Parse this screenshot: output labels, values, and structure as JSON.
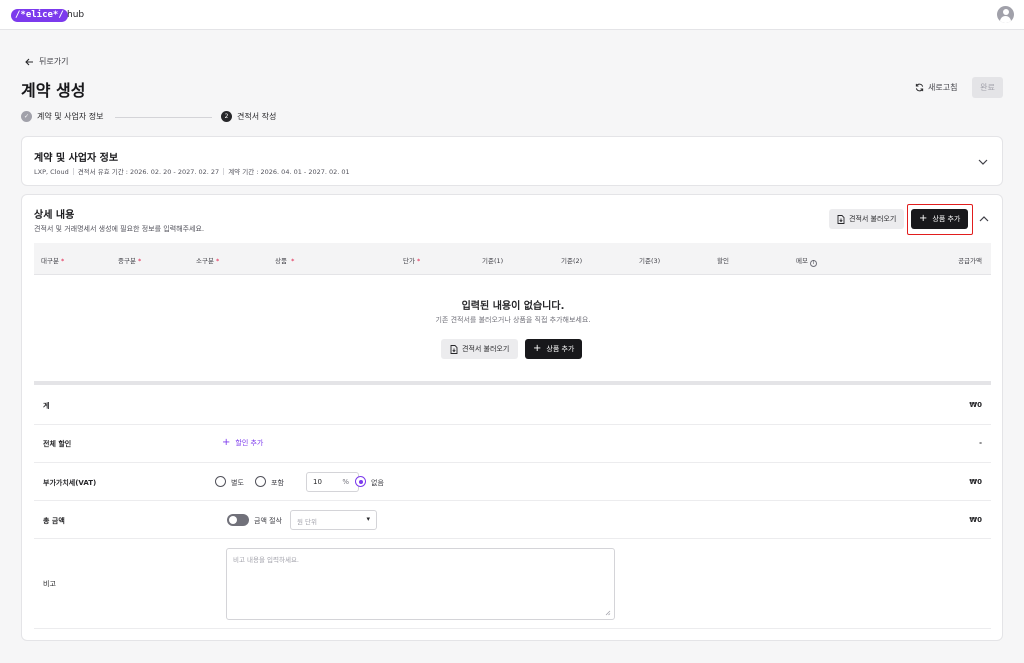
{
  "header": {
    "logo_text": "/*elice*/",
    "hub_label": "hub",
    "profile_icon": "user-avatar-icon"
  },
  "nav": {
    "back_label": "뒤로가기"
  },
  "page": {
    "title": "계약 생성",
    "refresh_label": "새로고침",
    "done_label": "완료"
  },
  "steps": [
    {
      "number": "✓",
      "label": "계약 및 사업자 정보",
      "status": "completed"
    },
    {
      "number": "2",
      "label": "견적서 작성",
      "status": "current"
    }
  ],
  "contract_card": {
    "title": "계약 및 사업자 정보",
    "products": "LXP, Cloud",
    "quote_validity": "견적서 유효 기간 : 2026. 02. 20 - 2027. 02. 27",
    "contract_period": "계약 기간 : 2026. 04. 01 - 2027. 02. 01"
  },
  "detail_card": {
    "title": "상세 내용",
    "subtitle": "견적서 및 거래명세서 생성에 필요한 정보를 입력해주세요.",
    "load_quote_label": "견적서 불러오기",
    "add_product_label": "상품 추가",
    "columns": [
      {
        "label": "대구분",
        "required": true
      },
      {
        "label": "중구분",
        "required": true
      },
      {
        "label": "소구분",
        "required": true
      },
      {
        "label": "상품",
        "required": true
      },
      {
        "label": "단가",
        "required": true
      },
      {
        "label": "기준(1)",
        "required": false
      },
      {
        "label": "기준(2)",
        "required": false
      },
      {
        "label": "기준(3)",
        "required": false
      },
      {
        "label": "할인",
        "required": false
      },
      {
        "label": "메모",
        "required": false
      },
      {
        "label": "공급가액",
        "required": false
      }
    ],
    "empty_title": "입력된 내용이 없습니다.",
    "empty_subtitle": "기존 견적서를 불러오거나 상품을 직접 추가해보세요.",
    "empty_load_label": "견적서 불러오기",
    "empty_add_label": "상품 추가"
  },
  "summary": {
    "subtotal_label": "계",
    "subtotal_value": "₩0",
    "discount_label": "전체 할인",
    "discount_add_label": "할인 추가",
    "discount_value": "-",
    "vat_label": "부가가치세(VAT)",
    "vat_options": [
      "별도",
      "포함",
      "없음"
    ],
    "vat_selected": "없음",
    "vat_rate": "10",
    "vat_unit": "%",
    "vat_value": "₩0",
    "total_label": "총 금액",
    "rounding_label": "금액 절삭",
    "rounding_placeholder": "원 단위",
    "total_value": "₩0",
    "memo_label": "비고",
    "memo_placeholder": "비고 내용을 입력하세요."
  }
}
